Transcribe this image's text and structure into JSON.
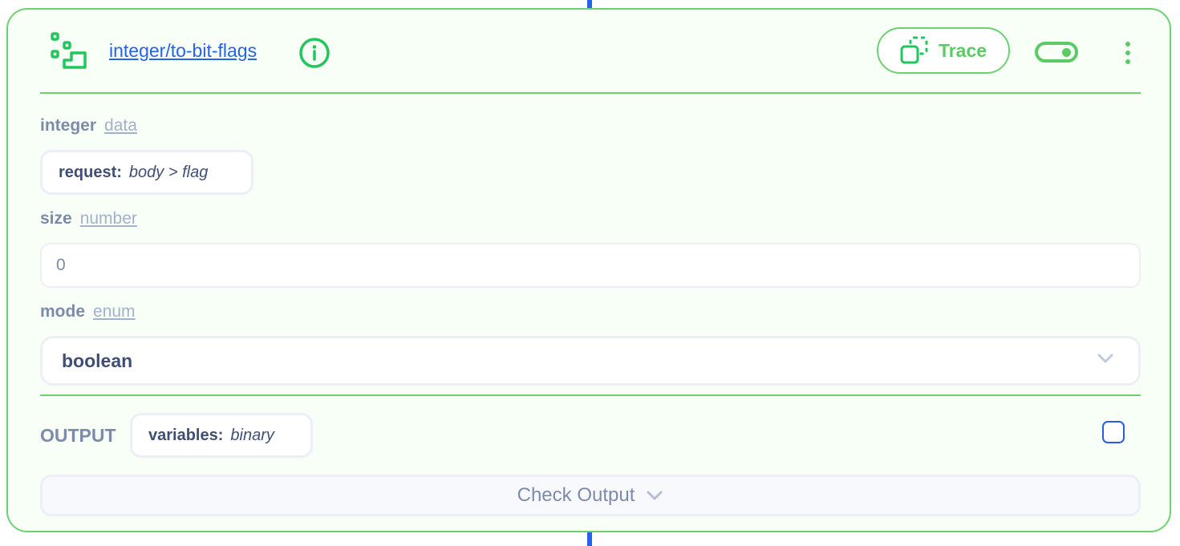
{
  "node": {
    "title": "integer/to-bit-flags",
    "icon": "bit-flags-icon",
    "trace_label": "Trace",
    "enabled": true,
    "colors": {
      "accent": "#5ccb66",
      "link": "#2563eb",
      "border": "#6bd26f",
      "connector": "#2563eb"
    }
  },
  "fields": [
    {
      "name": "integer",
      "type": "data",
      "value_source": "request:",
      "value_path": "body > flag"
    },
    {
      "name": "size",
      "type": "number",
      "value": "0"
    },
    {
      "name": "mode",
      "type": "enum",
      "selected": "boolean"
    }
  ],
  "output": {
    "label": "OUTPUT",
    "chip_source": "variables:",
    "chip_value": "binary",
    "checked": false,
    "check_output_label": "Check Output"
  }
}
